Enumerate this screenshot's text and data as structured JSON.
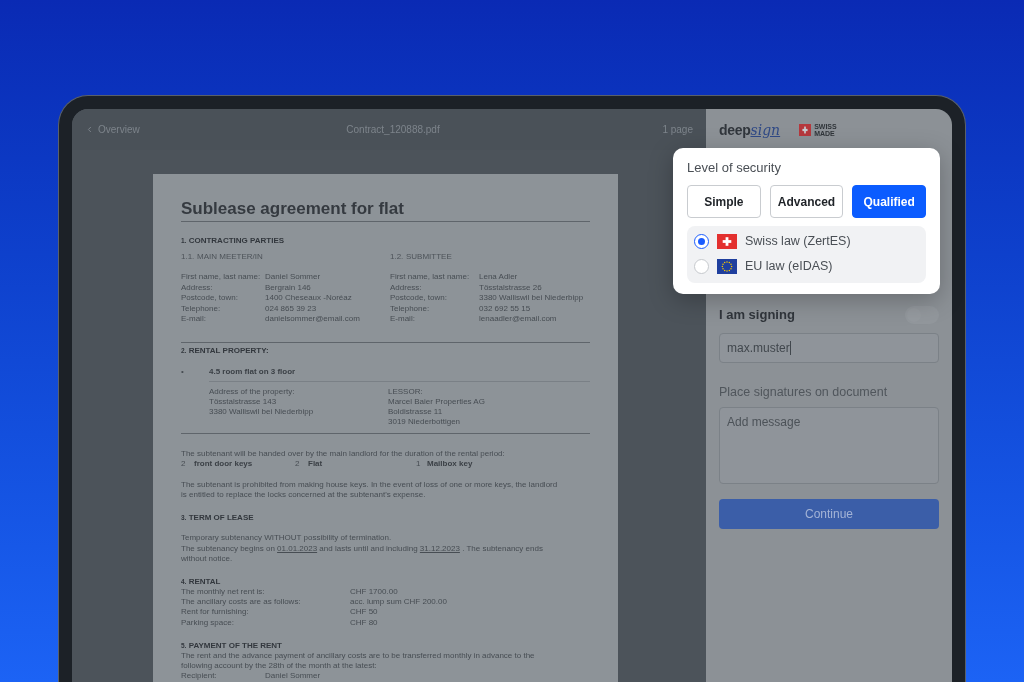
{
  "viewer": {
    "back_link": "Overview",
    "file_name": "Contract_120888.pdf",
    "page_count": "1 page"
  },
  "document": {
    "title": "Sublease agreement for flat",
    "parties": {
      "number": "1.",
      "heading": "CONTRACTING PARTIES",
      "columns": [
        {
          "number": "1.1.",
          "title": "MAIN MEETER/IN",
          "fields": [
            {
              "label": "First name, last name:",
              "value": "Daniel Sommer"
            },
            {
              "label": "Address:",
              "value": "Bergrain 146"
            },
            {
              "label": "Postcode, town:",
              "value": "1400 Cheseaux -Noréaz"
            },
            {
              "label": "Telephone:",
              "value": "024 865 39 23"
            },
            {
              "label": "E-mail:",
              "value": "danielsommer@email.com"
            }
          ]
        },
        {
          "number": "1.2.",
          "title": "SUBMITTEE",
          "fields": [
            {
              "label": "First name, last name:",
              "value": "Lena Adler"
            },
            {
              "label": "Address:",
              "value": "Tösstalstrasse 26"
            },
            {
              "label": "Postcode, town:",
              "value": "3380 Walliswil bei Niederbipp"
            },
            {
              "label": "Telephone:",
              "value": "032 692 55 15"
            },
            {
              "label": "E-mail:",
              "value": "lenaadler@email.com"
            }
          ]
        }
      ]
    },
    "property": {
      "number": "2.",
      "heading": "RENTAL PROPERTY:",
      "bullet": "•",
      "item": "4.5 room flat on 3 floor",
      "blocks": [
        {
          "label": "Address of the property:",
          "lines": [
            "Tösstalstrasse 143",
            "3380 Walliswil bei Niederbipp"
          ]
        },
        {
          "label": "LESSOR:",
          "lines": [
            "Marcel Baier Properties AG",
            "Boldistrasse 11",
            "3019 Niederbottigen"
          ]
        }
      ]
    },
    "keys": {
      "intro": "The subtenant will be handed over by the main landlord for the duration of the rental period:",
      "items": [
        {
          "count": "2",
          "name": "front door keys"
        },
        {
          "count": "2",
          "name": "Flat"
        },
        {
          "count": "1",
          "name": "Mailbox key"
        }
      ],
      "note": "The subtenant is prohibited from making house keys. In the event of loss of one or more keys, the landlord is entitled to replace the locks concerned at the subtenant's expense."
    },
    "term": {
      "number": "3.",
      "heading": "TERM OF LEASE",
      "statement": "Temporary subtenancy WITHOUT possibility of termination.",
      "period": [
        {
          "text": "The subtenancy begins on ",
          "underlined": false
        },
        {
          "text": "01.01.2023",
          "underlined": true
        },
        {
          "text": " and lasts until and including ",
          "underlined": false
        },
        {
          "text": "31.12.2023",
          "underlined": true
        },
        {
          "text": " . The subtenancy ends without notice.",
          "underlined": false
        }
      ]
    },
    "rental": {
      "number": "4.",
      "heading": "RENTAL",
      "rows": [
        {
          "label": "The monthly net rent is:",
          "value": "CHF 1700.00"
        },
        {
          "label": "The ancillary costs are as follows:",
          "value": "acc. lump sum CHF 200.00"
        },
        {
          "label": "Rent for furnishing:",
          "value": "CHF 50"
        },
        {
          "label": "Parking space:",
          "value": "CHF 80"
        }
      ]
    },
    "payment": {
      "number": "5.",
      "heading": "PAYMENT OF THE RENT",
      "text": "The rent and the advance payment of ancillary costs are to be transferred monthly in advance to the following account by the 28th of the month at the latest:",
      "rows": [
        {
          "label": "Recipient:",
          "value": "Daniel Sommer"
        }
      ]
    }
  },
  "brand": {
    "logo_first": "deep",
    "logo_second": "sign",
    "badge_lines": [
      "SWISS",
      "MADE"
    ]
  },
  "security": {
    "title": "Level of security",
    "levels": [
      {
        "label": "Simple",
        "selected": false
      },
      {
        "label": "Advanced",
        "selected": false
      },
      {
        "label": "Qualified",
        "selected": true
      }
    ],
    "options": [
      {
        "label": "Swiss law (ZertES)",
        "kind": "swiss",
        "selected": true
      },
      {
        "label": "EU law (eIDAS)",
        "kind": "eu",
        "selected": false
      }
    ]
  },
  "signing": {
    "label": "I am signing",
    "toggle": {
      "on": false
    },
    "input": {
      "value": "max.muster"
    },
    "placement_label": "Place signatures on document",
    "message": {
      "placeholder": "Add message"
    },
    "continue_button": "Continue"
  }
}
